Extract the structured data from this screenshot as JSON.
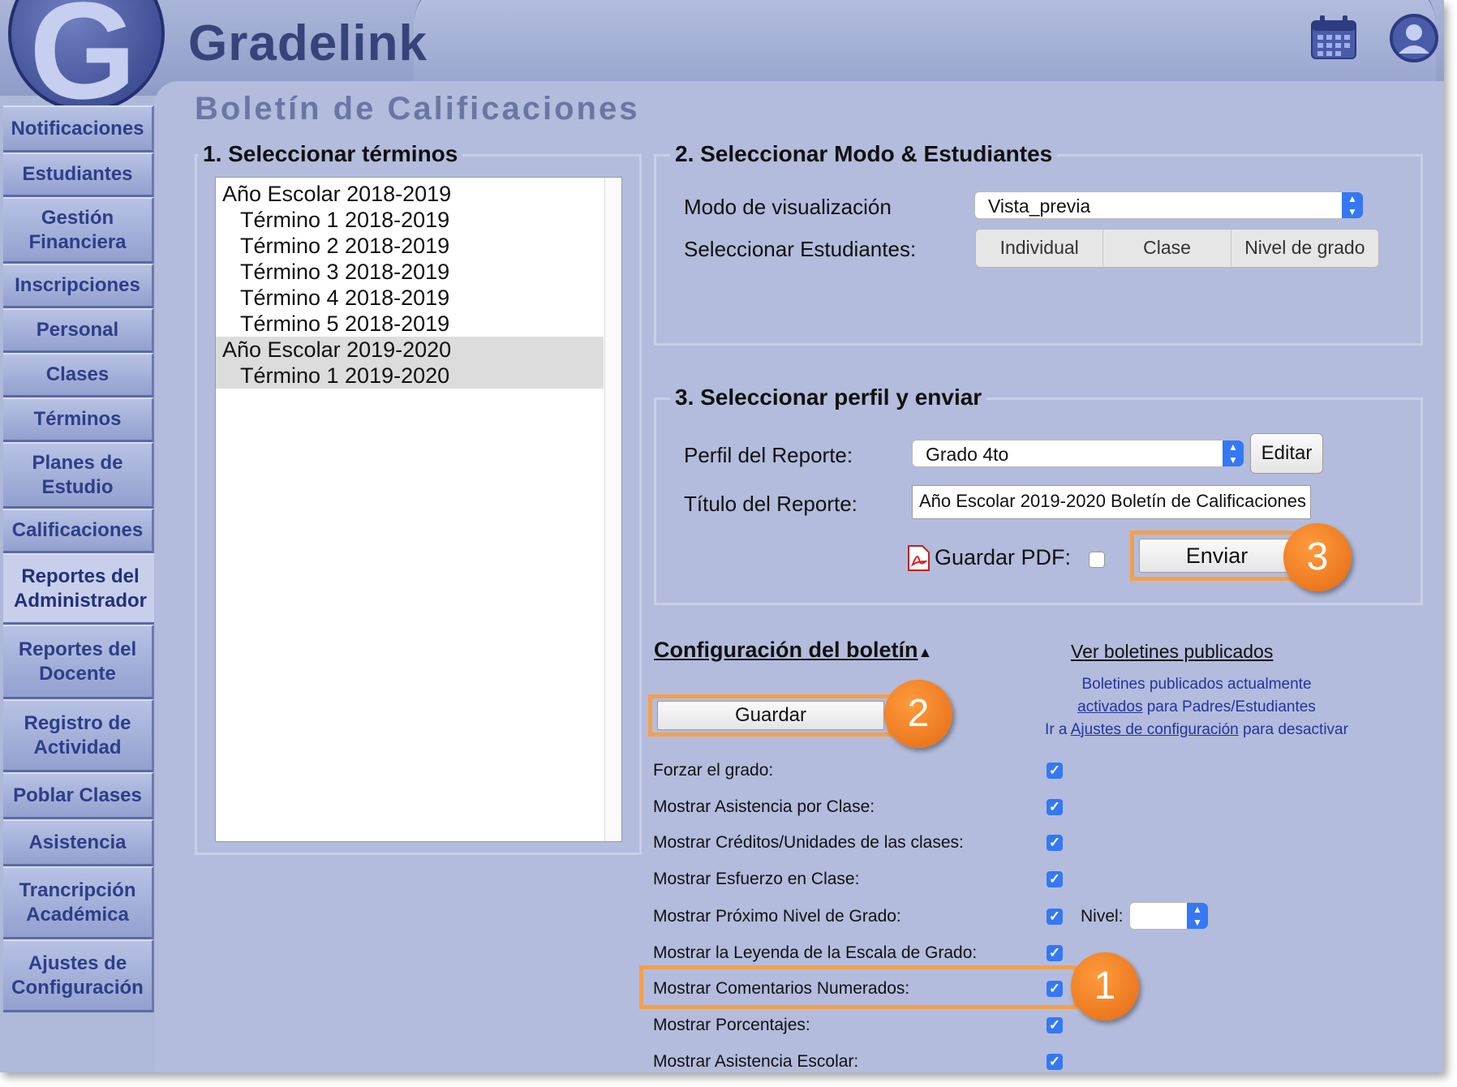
{
  "app": {
    "brand": "Gradelink",
    "logo_letter": "G"
  },
  "sidebar": {
    "items": [
      {
        "label": "Notificaciones",
        "active": false
      },
      {
        "label": "Estudiantes",
        "active": false
      },
      {
        "label": "Gestión Financiera",
        "active": false
      },
      {
        "label": "Inscripciones",
        "active": false
      },
      {
        "label": "Personal",
        "active": false
      },
      {
        "label": "Clases",
        "active": false
      },
      {
        "label": "Términos",
        "active": false
      },
      {
        "label": "Planes de Estudio",
        "active": false
      },
      {
        "label": "Calificaciones",
        "active": false
      },
      {
        "label": "Reportes del Administrador",
        "active": true
      },
      {
        "label": "Reportes del Docente",
        "active": false
      },
      {
        "label": "Registro de Actividad",
        "active": false
      },
      {
        "label": "Poblar Clases",
        "active": false
      },
      {
        "label": "Asistencia",
        "active": false
      },
      {
        "label": "Trancripción Académica",
        "active": false
      },
      {
        "label": "Ajustes de Configuración",
        "active": false
      }
    ]
  },
  "page": {
    "title": "Boletín de Calificaciones"
  },
  "terms": {
    "legend": "1. Seleccionar términos",
    "items": [
      {
        "label": "Año Escolar 2018-2019",
        "child": false,
        "selected": false
      },
      {
        "label": "Término 1 2018-2019",
        "child": true,
        "selected": false
      },
      {
        "label": "Término 2 2018-2019",
        "child": true,
        "selected": false
      },
      {
        "label": "Término 3 2018-2019",
        "child": true,
        "selected": false
      },
      {
        "label": "Término 4 2018-2019",
        "child": true,
        "selected": false
      },
      {
        "label": "Término 5 2018-2019",
        "child": true,
        "selected": false
      },
      {
        "label": "Año Escolar 2019-2020",
        "child": false,
        "selected": true
      },
      {
        "label": "Término 1 2019-2020",
        "child": true,
        "selected": true
      }
    ]
  },
  "mode": {
    "legend": "2. Seleccionar Modo & Estudiantes",
    "view_label": "Modo de visualización",
    "view_value": "Vista_previa",
    "students_label": "Seleccionar Estudiantes:",
    "segments": [
      "Individual",
      "Clase",
      "Nivel de grado"
    ]
  },
  "profile": {
    "legend": "3. Seleccionar perfil y enviar",
    "profile_label": "Perfil del Reporte:",
    "profile_value": "Grado 4to",
    "edit_label": "Editar",
    "title_label": "Título del Reporte:",
    "title_value": "Año Escolar 2019-2020 Boletín de Calificaciones",
    "pdf_label": "Guardar PDF:",
    "pdf_checked": false,
    "send_label": "Enviar"
  },
  "config": {
    "heading": "Configuración del boletín",
    "collapse_glyph": "▲",
    "save_label": "Guardar",
    "published_link": "Ver boletines publicados",
    "pub_line1": "Boletines publicados actualmente",
    "pub_line2_link": "activados",
    "pub_line2_rest": " para Padres/Estudiantes",
    "pub_line3_pre": "Ir a ",
    "pub_line3_link": "Ajustes de configuración",
    "pub_line3_post": " para desactivar",
    "level_label": "Nivel:",
    "level_value": "",
    "options": [
      {
        "label": "Forzar el grado:",
        "checked": true
      },
      {
        "label": "Mostrar Asistencia por Clase:",
        "checked": true
      },
      {
        "label": "Mostrar Créditos/Unidades de las clases:",
        "checked": true
      },
      {
        "label": "Mostrar Esfuerzo en Clase:",
        "checked": true
      },
      {
        "label": "Mostrar Próximo Nivel de Grado:",
        "checked": true
      },
      {
        "label": "Mostrar la Leyenda de la Escala de Grado:",
        "checked": true
      },
      {
        "label": "Mostrar Comentarios Numerados:",
        "checked": true
      },
      {
        "label": "Mostrar Porcentajes:",
        "checked": true
      },
      {
        "label": "Mostrar Asistencia Escolar:",
        "checked": true
      }
    ]
  },
  "annotations": {
    "step1": "1",
    "step2": "2",
    "step3": "3",
    "color": "#f5a04a"
  },
  "icons": {
    "calendar": "calendar-icon",
    "user": "user-icon",
    "pdf": "pdf-icon",
    "checkbox_mark": "✓"
  }
}
